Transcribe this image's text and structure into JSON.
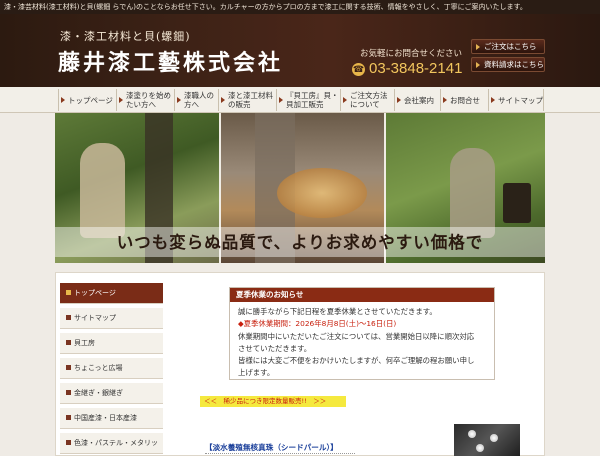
{
  "topline": "漆・漆芸材料(漆工材料)と貝(螺鈿 らでん)のことならお任せ下さい。カルチャーの方からプロの方まで漆工に関する技術、情報をやさしく、丁寧にご案内いたします。",
  "header": {
    "subtitle": "漆・漆工材料と貝(螺鈿)",
    "company": "藤井漆工藝株式会社",
    "contact_label": "お気軽にお問合せください",
    "phone": "03-3848-2141",
    "btn_contact": "ご注文はこちら",
    "btn_docs": "資料請求はこちら"
  },
  "nav": {
    "items": [
      "トップページ",
      "漆塗りを始めたい方へ",
      "漆職人の方へ",
      "漆と漆工材料の販売",
      "『貝工房』貝・貝加工販売",
      "ご注文方法について",
      "会社案内",
      "お問合せ",
      "サイトマップ"
    ]
  },
  "hero": {
    "slogan": "いつも変らぬ品質で、よりお求めやすい価格で"
  },
  "sidebar": {
    "items": [
      "トップページ",
      "サイトマップ",
      "貝工房",
      "ちょこっと広場",
      "金継ぎ・銀継ぎ",
      "中国産漆・日本産漆",
      "色漆・パステル・メタリック漆"
    ]
  },
  "notice": {
    "title": "夏季休業のお知らせ",
    "line1": "誠に勝手ながら下記日程を夏季休業とさせていただきます。",
    "line2": "◆夏季休業期間：2026年8月8日(土)～16日(日)",
    "line3": "休業期間中にいただいたご注文については、営業開始日以降に順次対応",
    "line4": "させていただきます。",
    "line5": "皆様には大変ご不便をおかけいたしますが、何卒ご理解の程お願い申し",
    "line6": "上げます。"
  },
  "promo": "＜＜　稀少品につき限定数量販売!!　＞＞",
  "product": "【淡水養殖無核真珠（シードパール）】",
  "colors": {
    "header_bg": "#3d2216",
    "accent": "#8a2b14",
    "phone": "#f2c65e",
    "promo_bg": "#f5e93e"
  }
}
